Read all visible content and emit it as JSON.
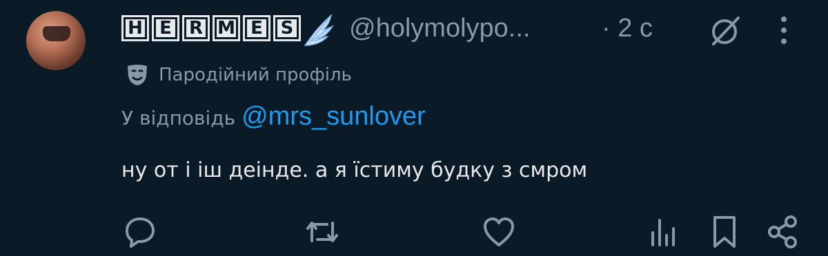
{
  "tweet": {
    "display_name_letters": [
      "H",
      "E",
      "R",
      "M",
      "E",
      "S"
    ],
    "handle": "@holymolypo...",
    "time": "· 2 с",
    "parody_label": "Пародійний профіль",
    "reply_prefix": "У відповідь",
    "reply_mention": "@mrs_sunlover",
    "text": "ну от і іш деінде. а я їстиму будку з смром"
  },
  "icons": {
    "grok": "grok-icon",
    "more": "more-vertical-icon",
    "parody": "theater-mask-icon",
    "reply": "comment-icon",
    "retweet": "retweet-icon",
    "like": "heart-icon",
    "views": "bar-chart-icon",
    "bookmark": "bookmark-icon",
    "share": "share-icon"
  },
  "colors": {
    "background": "#0b1a27",
    "text": "#e7e9ea",
    "muted": "#8b98a5",
    "accent": "#1d9bf0"
  }
}
